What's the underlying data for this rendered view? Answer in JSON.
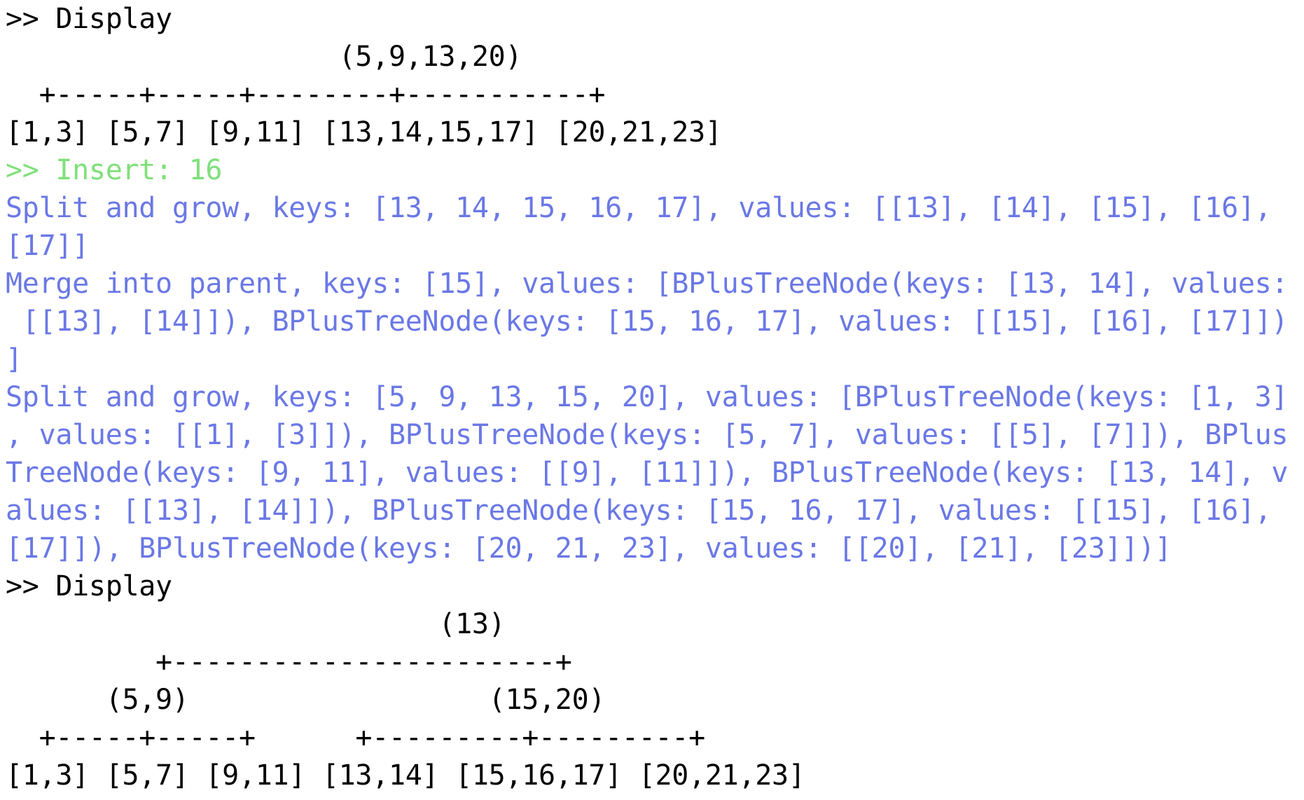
{
  "colors": {
    "background": "#ffffff",
    "text": "#000000",
    "command": "#7fe07a",
    "log": "#6a78e6"
  },
  "lines": [
    {
      "kind": "prompt",
      "text": ">> Display"
    },
    {
      "kind": "tree",
      "text": "                    (5,9,13,20)"
    },
    {
      "kind": "tree",
      "text": "  +-----+-----+--------+-----------+"
    },
    {
      "kind": "tree",
      "text": "[1,3] [5,7] [9,11] [13,14,15,17] [20,21,23]"
    },
    {
      "kind": "cmd",
      "text": ">> Insert: 16"
    },
    {
      "kind": "log",
      "text": "Split and grow, keys: [13, 14, 15, 16, 17], values: [[13], [14], [15], [16],"
    },
    {
      "kind": "log",
      "text": "[17]]"
    },
    {
      "kind": "log",
      "text": "Merge into parent, keys: [15], values: [BPlusTreeNode(keys: [13, 14], values:"
    },
    {
      "kind": "log",
      "text": " [[13], [14]]), BPlusTreeNode(keys: [15, 16, 17], values: [[15], [16], [17]])"
    },
    {
      "kind": "log",
      "text": "]"
    },
    {
      "kind": "log",
      "text": "Split and grow, keys: [5, 9, 13, 15, 20], values: [BPlusTreeNode(keys: [1, 3]"
    },
    {
      "kind": "log",
      "text": ", values: [[1], [3]]), BPlusTreeNode(keys: [5, 7], values: [[5], [7]]), BPlus"
    },
    {
      "kind": "log",
      "text": "TreeNode(keys: [9, 11], values: [[9], [11]]), BPlusTreeNode(keys: [13, 14], v"
    },
    {
      "kind": "log",
      "text": "alues: [[13], [14]]), BPlusTreeNode(keys: [15, 16, 17], values: [[15], [16],"
    },
    {
      "kind": "log",
      "text": "[17]]), BPlusTreeNode(keys: [20, 21, 23], values: [[20], [21], [23]])]"
    },
    {
      "kind": "prompt",
      "text": ">> Display"
    },
    {
      "kind": "tree",
      "text": "                          (13)"
    },
    {
      "kind": "tree",
      "text": "         +-----------------------+"
    },
    {
      "kind": "tree",
      "text": "      (5,9)                  (15,20)"
    },
    {
      "kind": "tree",
      "text": "  +-----+-----+      +---------+---------+"
    },
    {
      "kind": "tree",
      "text": "[1,3] [5,7] [9,11] [13,14] [15,16,17] [20,21,23]"
    }
  ]
}
